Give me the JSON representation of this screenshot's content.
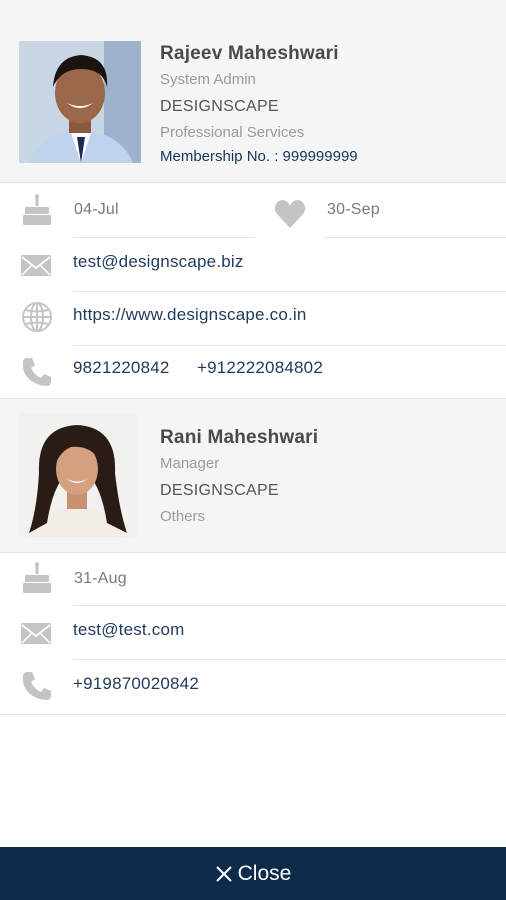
{
  "contacts": [
    {
      "name": "Rajeev Maheshwari",
      "role": "System Admin",
      "company": "DESIGNSCAPE",
      "industry": "Professional Services",
      "membership": "Membership No. : 999999999",
      "birthday": "04-Jul",
      "anniversary": "30-Sep",
      "email": "test@designscape.biz",
      "website": "https://www.designscape.co.in",
      "phone1": "9821220842",
      "phone2": "+912222084802"
    },
    {
      "name": "Rani Maheshwari",
      "role": "Manager",
      "company": "DESIGNSCAPE",
      "industry": "Others",
      "birthday": "31-Aug",
      "email": "test@test.com",
      "phone1": "+919870020842"
    }
  ],
  "close_label": "Close",
  "icons": {
    "birthday": "cake-icon",
    "anniversary": "heart-icon",
    "email": "envelope-icon",
    "website": "globe-icon",
    "phone": "phone-icon",
    "close": "close-icon"
  },
  "colors": {
    "footer": "#0f2b4c",
    "text_primary": "#1f3a5c",
    "icon": "#c4c4c4"
  }
}
